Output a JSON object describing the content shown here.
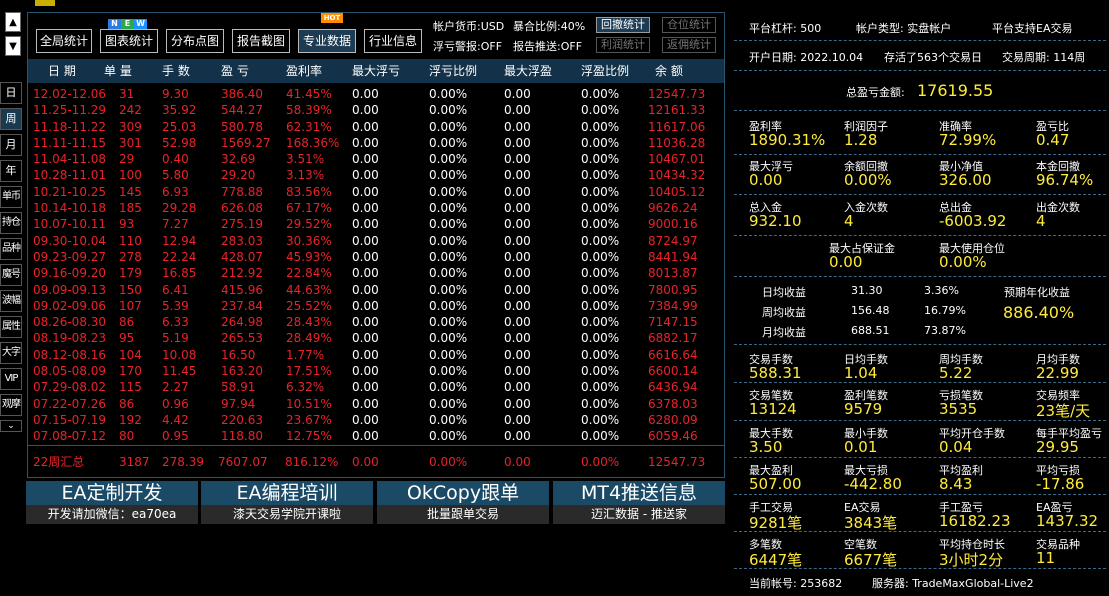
{
  "side": {
    "up_arrow": "▲",
    "down_arrow": "▼",
    "tabs": [
      "日",
      "周",
      "月",
      "年",
      "单币",
      "持仓",
      "品种",
      "魔号",
      "波幅",
      "属性",
      "大字",
      "VIP",
      "观摩"
    ],
    "more": "⌄"
  },
  "toolbar": {
    "buttons": [
      "全局统计",
      "图表统计",
      "分布点图",
      "报告截图",
      "专业数据",
      "行业信息"
    ],
    "new_badge": [
      "N",
      "E",
      "W"
    ],
    "hot_badge": "HOT",
    "currency": "帐户货币:USD",
    "exposure": "暴合比例:40%",
    "float_alert": "浮亏警报:OFF",
    "report_push": "报告推送:OFF",
    "small_buttons": [
      "回撤统计",
      "仓位统计",
      "利润统计",
      "返佣统计"
    ]
  },
  "table": {
    "headers": [
      "日 期",
      "单 量",
      "手 数",
      "盈 亏",
      "盈利率",
      "最大浮亏",
      "浮亏比例",
      "最大浮盈",
      "浮盈比例",
      "余 额"
    ],
    "rows": [
      [
        "12.02-12.06",
        "31",
        "9.30",
        "386.40",
        "41.45%",
        "0.00",
        "0.00%",
        "0.00",
        "0.00%",
        "12547.73"
      ],
      [
        "11.25-11.29",
        "242",
        "35.92",
        "544.27",
        "58.39%",
        "0.00",
        "0.00%",
        "0.00",
        "0.00%",
        "12161.33"
      ],
      [
        "11.18-11.22",
        "309",
        "25.03",
        "580.78",
        "62.31%",
        "0.00",
        "0.00%",
        "0.00",
        "0.00%",
        "11617.06"
      ],
      [
        "11.11-11.15",
        "301",
        "52.98",
        "1569.27",
        "168.36%",
        "0.00",
        "0.00%",
        "0.00",
        "0.00%",
        "11036.28"
      ],
      [
        "11.04-11.08",
        "29",
        "0.40",
        "32.69",
        "3.51%",
        "0.00",
        "0.00%",
        "0.00",
        "0.00%",
        "10467.01"
      ],
      [
        "10.28-11.01",
        "100",
        "5.80",
        "29.20",
        "3.13%",
        "0.00",
        "0.00%",
        "0.00",
        "0.00%",
        "10434.32"
      ],
      [
        "10.21-10.25",
        "145",
        "6.93",
        "778.88",
        "83.56%",
        "0.00",
        "0.00%",
        "0.00",
        "0.00%",
        "10405.12"
      ],
      [
        "10.14-10.18",
        "185",
        "29.28",
        "626.08",
        "67.17%",
        "0.00",
        "0.00%",
        "0.00",
        "0.00%",
        "9626.24"
      ],
      [
        "10.07-10.11",
        "93",
        "7.27",
        "275.19",
        "29.52%",
        "0.00",
        "0.00%",
        "0.00",
        "0.00%",
        "9000.16"
      ],
      [
        "09.30-10.04",
        "110",
        "12.94",
        "283.03",
        "30.36%",
        "0.00",
        "0.00%",
        "0.00",
        "0.00%",
        "8724.97"
      ],
      [
        "09.23-09.27",
        "278",
        "22.24",
        "428.07",
        "45.93%",
        "0.00",
        "0.00%",
        "0.00",
        "0.00%",
        "8441.94"
      ],
      [
        "09.16-09.20",
        "179",
        "16.85",
        "212.92",
        "22.84%",
        "0.00",
        "0.00%",
        "0.00",
        "0.00%",
        "8013.87"
      ],
      [
        "09.09-09.13",
        "150",
        "6.41",
        "415.96",
        "44.63%",
        "0.00",
        "0.00%",
        "0.00",
        "0.00%",
        "7800.95"
      ],
      [
        "09.02-09.06",
        "107",
        "5.39",
        "237.84",
        "25.52%",
        "0.00",
        "0.00%",
        "0.00",
        "0.00%",
        "7384.99"
      ],
      [
        "08.26-08.30",
        "86",
        "6.33",
        "264.98",
        "28.43%",
        "0.00",
        "0.00%",
        "0.00",
        "0.00%",
        "7147.15"
      ],
      [
        "08.19-08.23",
        "95",
        "5.19",
        "265.53",
        "28.49%",
        "0.00",
        "0.00%",
        "0.00",
        "0.00%",
        "6882.17"
      ],
      [
        "08.12-08.16",
        "104",
        "10.08",
        "16.50",
        "1.77%",
        "0.00",
        "0.00%",
        "0.00",
        "0.00%",
        "6616.64"
      ],
      [
        "08.05-08.09",
        "170",
        "11.45",
        "163.20",
        "17.51%",
        "0.00",
        "0.00%",
        "0.00",
        "0.00%",
        "6600.14"
      ],
      [
        "07.29-08.02",
        "115",
        "2.27",
        "58.91",
        "6.32%",
        "0.00",
        "0.00%",
        "0.00",
        "0.00%",
        "6436.94"
      ],
      [
        "07.22-07.26",
        "86",
        "0.96",
        "97.94",
        "10.51%",
        "0.00",
        "0.00%",
        "0.00",
        "0.00%",
        "6378.03"
      ],
      [
        "07.15-07.19",
        "192",
        "4.42",
        "220.63",
        "23.67%",
        "0.00",
        "0.00%",
        "0.00",
        "0.00%",
        "6280.09"
      ],
      [
        "07.08-07.12",
        "80",
        "0.95",
        "118.80",
        "12.75%",
        "0.00",
        "0.00%",
        "0.00",
        "0.00%",
        "6059.46"
      ]
    ],
    "summary": [
      "22周汇总",
      "3187",
      "278.39",
      "7607.07",
      "816.12%",
      "0.00",
      "0.00%",
      "0.00",
      "0.00%",
      "12547.73"
    ]
  },
  "promos": [
    {
      "title": "EA定制开发",
      "sub": "开发请加微信：ea70ea"
    },
    {
      "title": "EA编程培训",
      "sub": "漆天交易学院开课啦"
    },
    {
      "title": "OkCopy跟单",
      "sub": "批量跟单交易"
    },
    {
      "title": "MT4推送信息",
      "sub": "迈汇数据 - 推送家"
    }
  ],
  "stats": {
    "leverage": "平台杠杆:  500",
    "account_type": "帐户类型:  实盘帐户",
    "ea_support": "平台支持EA交易",
    "open_date": "开户日期:  2022.10.04",
    "alive": "存活了563个交易日",
    "period": "交易周期:  114周",
    "total_pl_label": "总盈亏金额:",
    "total_pl": "17619.55",
    "g1": [
      {
        "label": "盈利率",
        "value": "1890.31%"
      },
      {
        "label": "利润因子",
        "value": "1.28"
      },
      {
        "label": "准确率",
        "value": "72.99%"
      },
      {
        "label": "盈亏比",
        "value": "0.47"
      }
    ],
    "g2": [
      {
        "label": "最大浮亏",
        "value": "0.00"
      },
      {
        "label": "余额回撤",
        "value": "0.00%"
      },
      {
        "label": "最小净值",
        "value": "326.00"
      },
      {
        "label": "本金回撤",
        "value": "96.74%"
      }
    ],
    "g3": [
      {
        "label": "总入金",
        "value": "932.10"
      },
      {
        "label": "入金次数",
        "value": "4"
      },
      {
        "label": "总出金",
        "value": "-6003.92"
      },
      {
        "label": "出金次数",
        "value": "4"
      }
    ],
    "g4": [
      {
        "label": "最大占保证金",
        "value": "0.00"
      },
      {
        "label": "最大使用仓位",
        "value": "0.00%"
      }
    ],
    "avg": {
      "daily_label": "日均收益",
      "daily_val": "31.30",
      "daily_pct": "3.36%",
      "weekly_label": "周均收益",
      "weekly_val": "156.48",
      "weekly_pct": "16.79%",
      "monthly_label": "月均收益",
      "monthly_val": "688.51",
      "monthly_pct": "73.87%",
      "annual_label": "预期年化收益",
      "annual": "886.40%"
    },
    "g5": [
      {
        "label": "交易手数",
        "value": "588.31"
      },
      {
        "label": "日均手数",
        "value": "1.04"
      },
      {
        "label": "周均手数",
        "value": "5.22"
      },
      {
        "label": "月均手数",
        "value": "22.99"
      }
    ],
    "g6": [
      {
        "label": "交易笔数",
        "value": "13124"
      },
      {
        "label": "盈利笔数",
        "value": "9579"
      },
      {
        "label": "亏损笔数",
        "value": "3535"
      },
      {
        "label": "交易频率",
        "value": "23笔/天"
      }
    ],
    "g7": [
      {
        "label": "最大手数",
        "value": "3.50"
      },
      {
        "label": "最小手数",
        "value": "0.01"
      },
      {
        "label": "平均开仓手数",
        "value": "0.04"
      },
      {
        "label": "每手平均盈亏",
        "value": "29.95"
      }
    ],
    "g8": [
      {
        "label": "最大盈利",
        "value": "507.00"
      },
      {
        "label": "最大亏损",
        "value": "-442.80"
      },
      {
        "label": "平均盈利",
        "value": "8.43"
      },
      {
        "label": "平均亏损",
        "value": "-17.86"
      }
    ],
    "g9": [
      {
        "label": "手工交易",
        "value": "9281笔"
      },
      {
        "label": "EA交易",
        "value": "3843笔"
      },
      {
        "label": "手工盈亏",
        "value": "16182.23"
      },
      {
        "label": "EA盈亏",
        "value": "1437.32"
      }
    ],
    "g10": [
      {
        "label": "多笔数",
        "value": "6447笔"
      },
      {
        "label": "空笔数",
        "value": "6677笔"
      },
      {
        "label": "平均持仓时长",
        "value": "3小时2分"
      },
      {
        "label": "交易品种",
        "value": "11"
      }
    ],
    "account": "当前帐号:  253682",
    "server": "服务器:  TradeMaxGlobal-Live2"
  },
  "colors": {
    "accent": "#133249",
    "loss_red": "#e8232a",
    "value_yellow": "#ffeb3b",
    "hot": "#ff8c00"
  }
}
